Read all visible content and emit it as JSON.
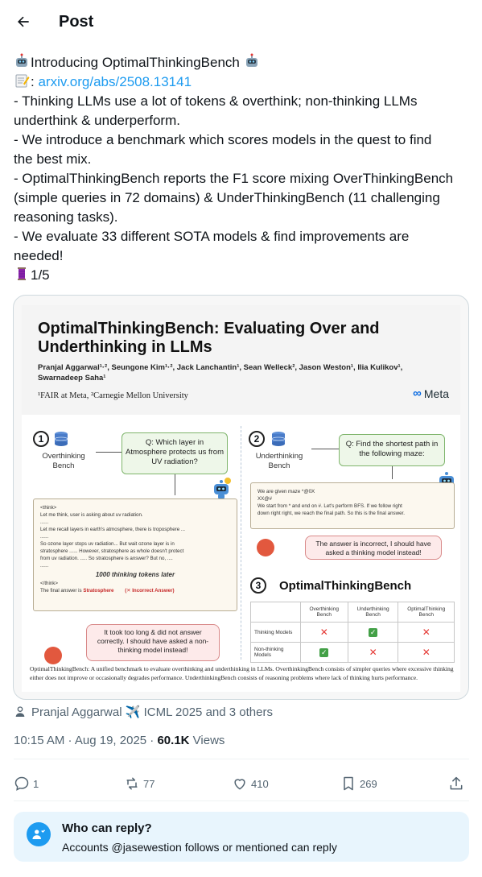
{
  "header": {
    "title": "Post",
    "back_icon": "arrow-left-icon"
  },
  "post": {
    "lines": [
      "Introducing OptimalThinkingBench ",
      ": ",
      "- Thinking LLMs use a lot of tokens & overthink; non-thinking LLMs",
      "underthink & underperform.",
      "- We introduce a benchmark which scores models in the quest to find",
      "the best mix.",
      "- OptimalThinkingBench reports the F1 score mixing OverThinkingBench",
      "(simple queries in 72 domains) & UnderThinkingBench (11 challenging",
      "reasoning tasks).",
      "- We evaluate 33 different SOTA models & find improvements are",
      "needed!",
      "1/5"
    ],
    "link": "arxiv.org/abs/2508.13141",
    "emojis": [
      "robot-emoji",
      "memo-emoji",
      "thread-emoji"
    ]
  },
  "figure": {
    "title_line1": "OptimalThinkingBench: Evaluating Over and",
    "title_line2": "Underthinking in LLMs",
    "authors_line1": "Pranjal Aggarwal¹·², Seungone Kim¹·², Jack Lanchantin¹, Sean Welleck², Jason Weston¹, Ilia Kulikov¹,",
    "authors_line2": "Swarnadeep Saha¹",
    "affiliation": "¹FAIR at Meta, ²Carnegie Mellon University",
    "logo_text": "Meta",
    "panel1": {
      "num": "1",
      "bench": "Overthinking Bench",
      "question": "Q: Which layer in Atmosphere protects us from UV radiation?",
      "trace": [
        "<think>",
        "Let me think, user is asking about uv radiation.",
        "......",
        "Let me recall layers in earth's atmosphere, there is troposphere ...",
        "......",
        "So ozone layer stops uv radiation... But wait ozone layer is in",
        "stratosphere ...... However, stratosphere as whole doesn't protect",
        "from uv radiation. ..... So stratosphere is answer? But no, ....",
        "......"
      ],
      "tokens_note": "1000 thinking tokens later",
      "close_think": "</think>",
      "final_prefix": "The final answer is ",
      "final_answer": "Stratosphere",
      "verdict": "(✕ Incorrect Answer)",
      "callout": "It took too long & did not answer correctly. I should have asked a non-thinking model instead!"
    },
    "panel2": {
      "num": "2",
      "bench": "Underthinking Bench",
      "question": "Q: Find the shortest path in the following maze:",
      "trace": [
        "We are given maze  *@0X",
        "                                XX@#",
        "",
        "We start from * and end on #. Let's perform BFS. If we follow right",
        "down right right, we reach the final path. So this is the final answer."
      ],
      "callout": "The answer is incorrect, I should have asked a thinking model instead!"
    },
    "panel3": {
      "num": "3",
      "title": "OptimalThinkingBench",
      "columns": [
        "",
        "Overthinking Bench",
        "Underthinking Bench",
        "OptimalThinking Bench"
      ],
      "rows": [
        {
          "label": "Thinking Models",
          "cells": [
            "x",
            "check",
            "x"
          ]
        },
        {
          "label": "Non-thinking Models",
          "cells": [
            "check",
            "x",
            "x"
          ]
        }
      ]
    },
    "caption": "OptimalThinkingBench: A unified benchmark to evaluate overthinking and underthinking in LLMs. OverthinkingBench consists of simpler queries where excessive thinking either does not improve or occasionally degrades performance. UnderthinkingBench consists of reasoning problems where lack of thinking hurts performance."
  },
  "tagged": {
    "text": "Pranjal Aggarwal ✈️ ICML 2025 and 3 others",
    "icon": "person-icon"
  },
  "timestamp": {
    "time": "10:15 AM · Aug 19, 2025 · ",
    "views_count": "60.1K",
    "views_label": " Views"
  },
  "actions": {
    "replies": "1",
    "reposts": "77",
    "likes": "410",
    "bookmarks": "269"
  },
  "reply_settings": {
    "title": "Who can reply?",
    "subtitle": "Accounts @jasewestion follows or mentioned can reply"
  },
  "colors": {
    "accent": "#1d9bf0",
    "text": "#0f1419",
    "secondary": "#536471",
    "border": "#cfd9de"
  }
}
